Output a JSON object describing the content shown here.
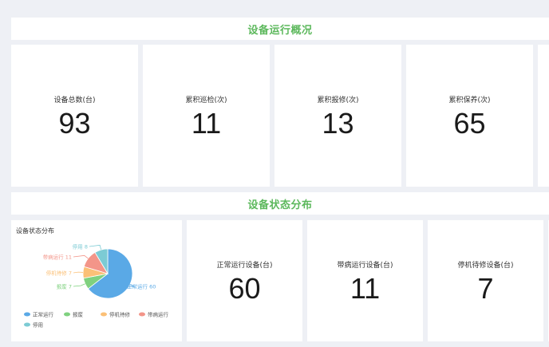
{
  "overview": {
    "title": "设备运行概况",
    "cards": [
      {
        "label": "设备总数(台)",
        "value": "93"
      },
      {
        "label": "累积巡检(次)",
        "value": "11"
      },
      {
        "label": "累积报修(次)",
        "value": "13"
      },
      {
        "label": "累积保养(次)",
        "value": "65"
      }
    ]
  },
  "status": {
    "title": "设备状态分布",
    "cards": [
      {
        "label": "正常运行设备(台)",
        "value": "60"
      },
      {
        "label": "带病运行设备(台)",
        "value": "11"
      },
      {
        "label": "停机待修设备(台)",
        "value": "7"
      }
    ]
  },
  "chart_data": {
    "type": "pie",
    "title": "设备状态分布",
    "slices": [
      {
        "name": "正常运行",
        "value": 60,
        "color": "#5aa9e6"
      },
      {
        "name": "报废",
        "value": 7,
        "color": "#7fd17f"
      },
      {
        "name": "停机待修",
        "value": 7,
        "color": "#fbc077"
      },
      {
        "name": "带病运行",
        "value": 11,
        "color": "#f39589"
      },
      {
        "name": "停用",
        "value": 8,
        "color": "#7ccbd4"
      }
    ],
    "labels": [
      {
        "text": "正常运行 60",
        "color": "#5aa9e6"
      },
      {
        "text": "报废 7",
        "color": "#7fd17f"
      },
      {
        "text": "停机待修 7",
        "color": "#fbc077"
      },
      {
        "text": "带病运行 11",
        "color": "#f39589"
      },
      {
        "text": "停用 8",
        "color": "#7ccbd4"
      }
    ],
    "legend": [
      {
        "name": "正常运行",
        "color": "#5aa9e6"
      },
      {
        "name": "报废",
        "color": "#7fd17f"
      },
      {
        "name": "停机待修",
        "color": "#fbc077"
      },
      {
        "name": "带病运行",
        "color": "#f39589"
      },
      {
        "name": "停用",
        "color": "#7ccbd4"
      }
    ]
  }
}
